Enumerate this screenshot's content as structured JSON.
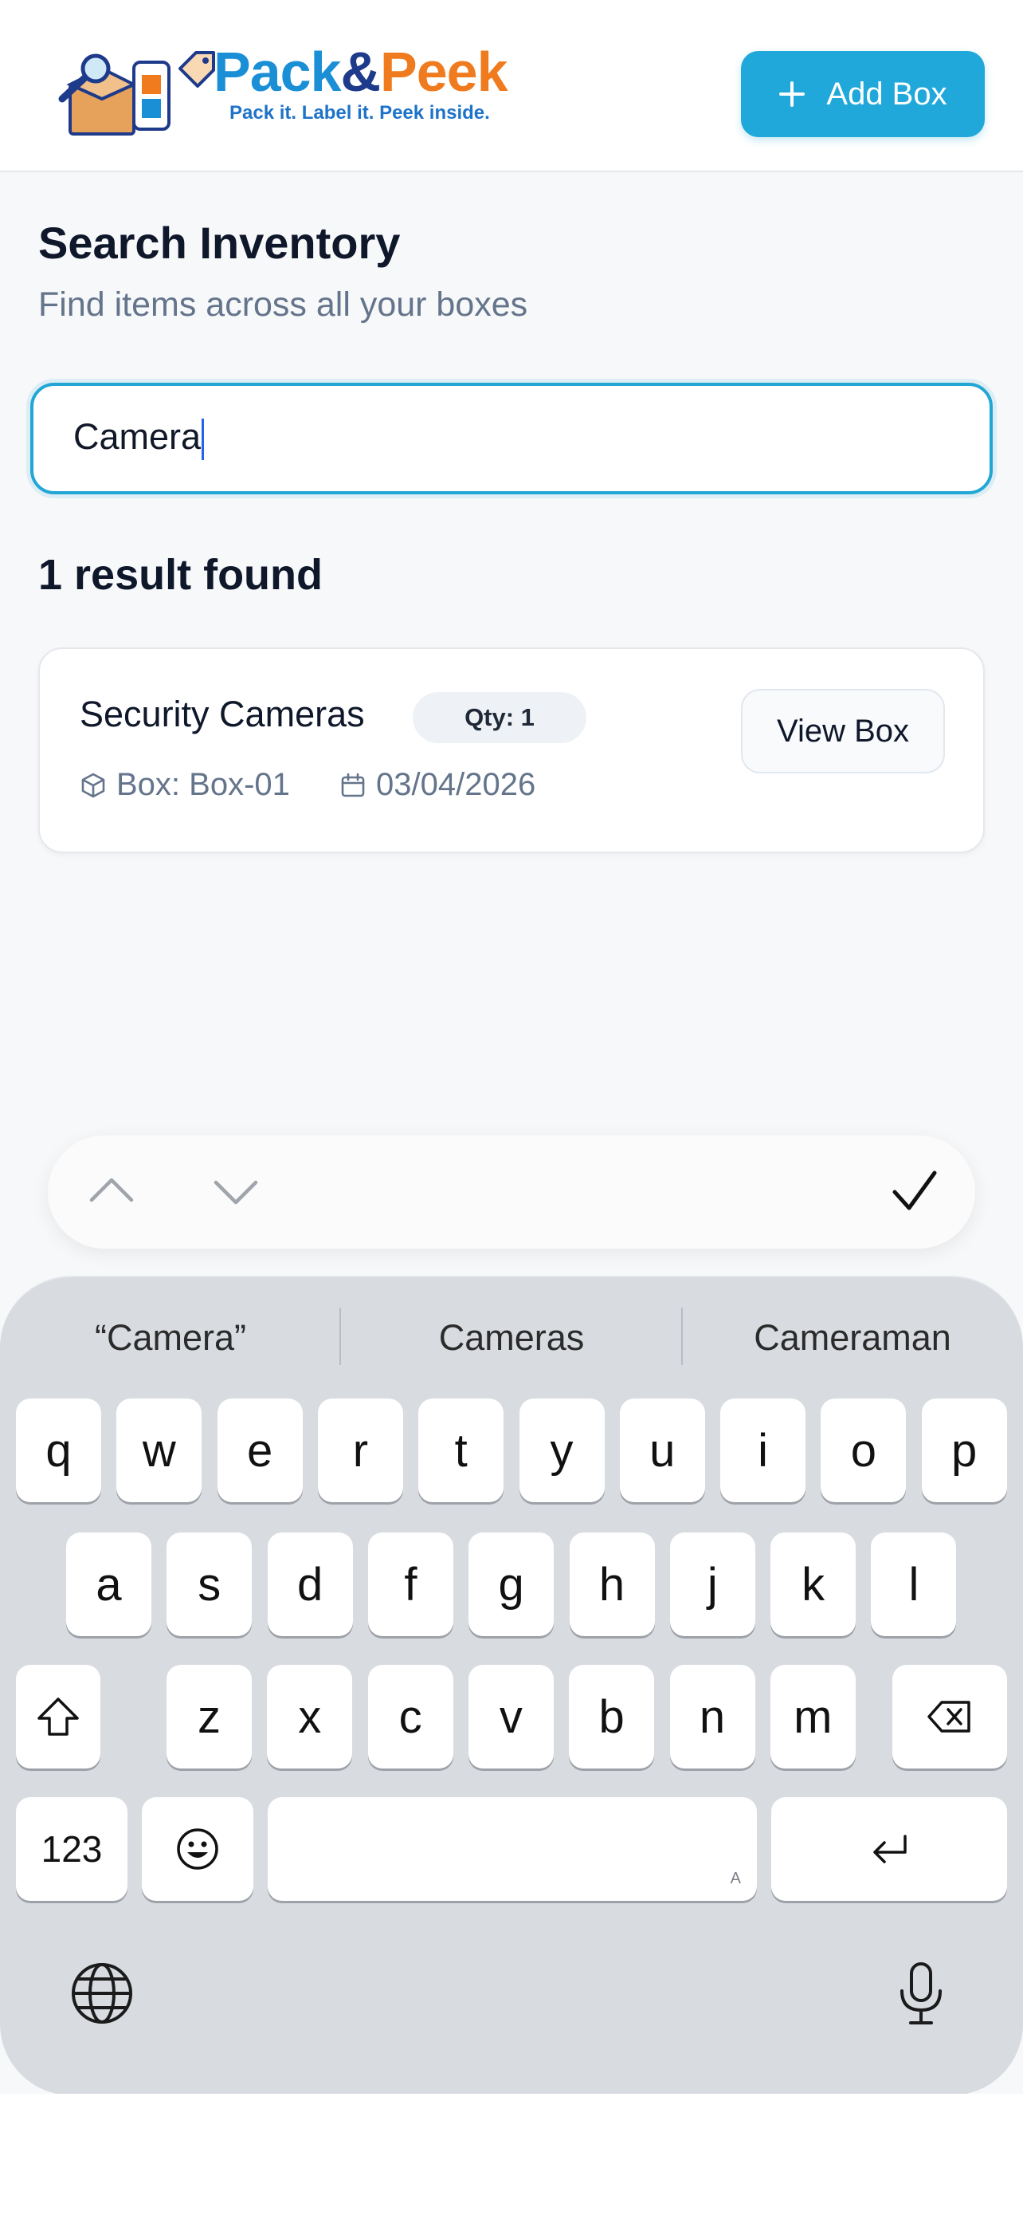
{
  "header": {
    "logo_primary": "Pack",
    "logo_amp": "&",
    "logo_secondary": "Peek",
    "tagline": "Pack it. Label it. Peek inside.",
    "add_box_label": "Add Box"
  },
  "search": {
    "title": "Search Inventory",
    "subtitle": "Find items across all your boxes",
    "query": "Camera",
    "result_count": "1 result found"
  },
  "results": [
    {
      "name": "Security Cameras",
      "qty": "Qty: 1",
      "box": "Box: Box-01",
      "date": "03/04/2026",
      "action": "View Box"
    }
  ],
  "keyboard": {
    "suggestions": [
      "“Camera”",
      "Cameras",
      "Cameraman"
    ],
    "row1": [
      "q",
      "w",
      "e",
      "r",
      "t",
      "y",
      "u",
      "i",
      "o",
      "p"
    ],
    "row2": [
      "a",
      "s",
      "d",
      "f",
      "g",
      "h",
      "j",
      "k",
      "l"
    ],
    "row3": [
      "z",
      "x",
      "c",
      "v",
      "b",
      "n",
      "m"
    ],
    "numbers_key": "123",
    "space_hint": "A"
  },
  "colors": {
    "accent": "#1fa8d9",
    "brand_blue": "#1a8fd6",
    "brand_orange": "#f07b1f"
  }
}
